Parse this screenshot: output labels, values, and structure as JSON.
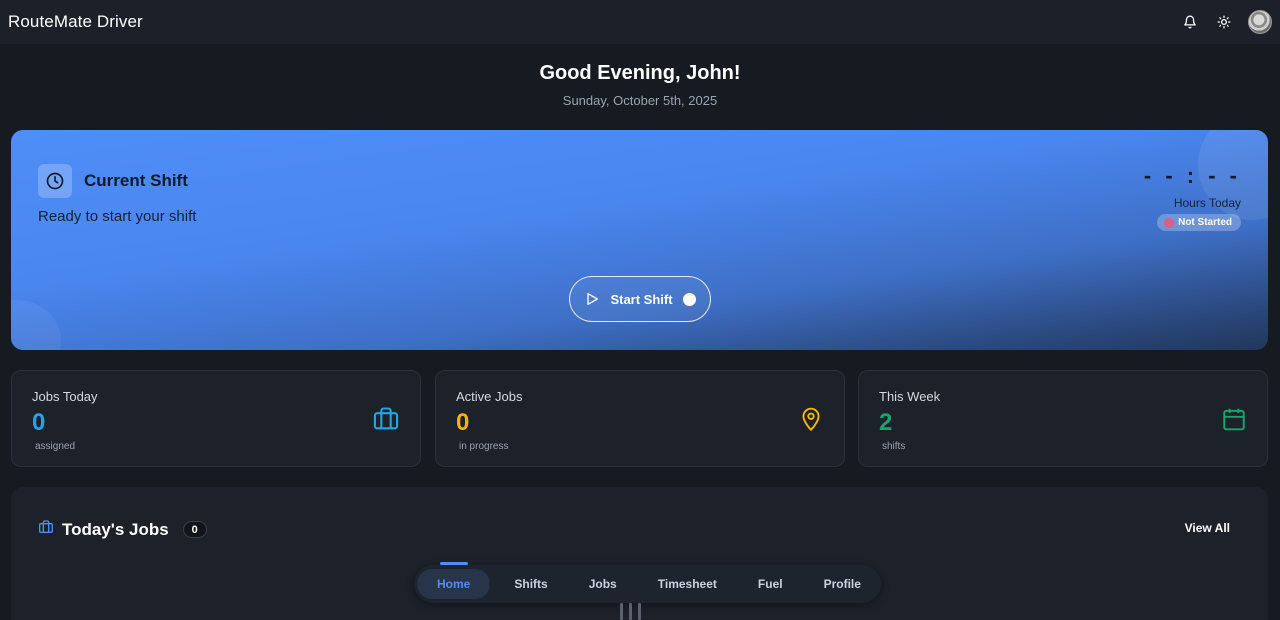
{
  "header": {
    "app_title": "RouteMate Driver",
    "icons": [
      "bell-icon",
      "sun-icon",
      "avatar"
    ]
  },
  "greeting": {
    "title": "Good Evening, John!",
    "date": "Sunday, October 5th, 2025"
  },
  "shift": {
    "title": "Current Shift",
    "subtitle": "Ready to start your shift",
    "hours_value": "- - : - -",
    "hours_label": "Hours Today",
    "status": "Not Started",
    "start_button": "Start Shift",
    "colors": {
      "gradient_start": "#4f8ef7",
      "gradient_end": "#22375a"
    }
  },
  "stats": [
    {
      "label": "Jobs Today",
      "value": "0",
      "unit": "assigned",
      "icon": "briefcase-icon",
      "color": "#1fa8e8"
    },
    {
      "label": "Active Jobs",
      "value": "0",
      "unit": "in progress",
      "icon": "map-pin-icon",
      "color": "#f4b400"
    },
    {
      "label": "This Week",
      "value": "2",
      "unit": "shifts",
      "icon": "calendar-icon",
      "color": "#1aa36b"
    }
  ],
  "jobs": {
    "title": "Today's Jobs",
    "count": "0",
    "view_all": "View All"
  },
  "nav": {
    "items": [
      "Home",
      "Shifts",
      "Jobs",
      "Timesheet",
      "Fuel",
      "Profile"
    ],
    "active": "Home",
    "accent": "#4f8ef7"
  }
}
